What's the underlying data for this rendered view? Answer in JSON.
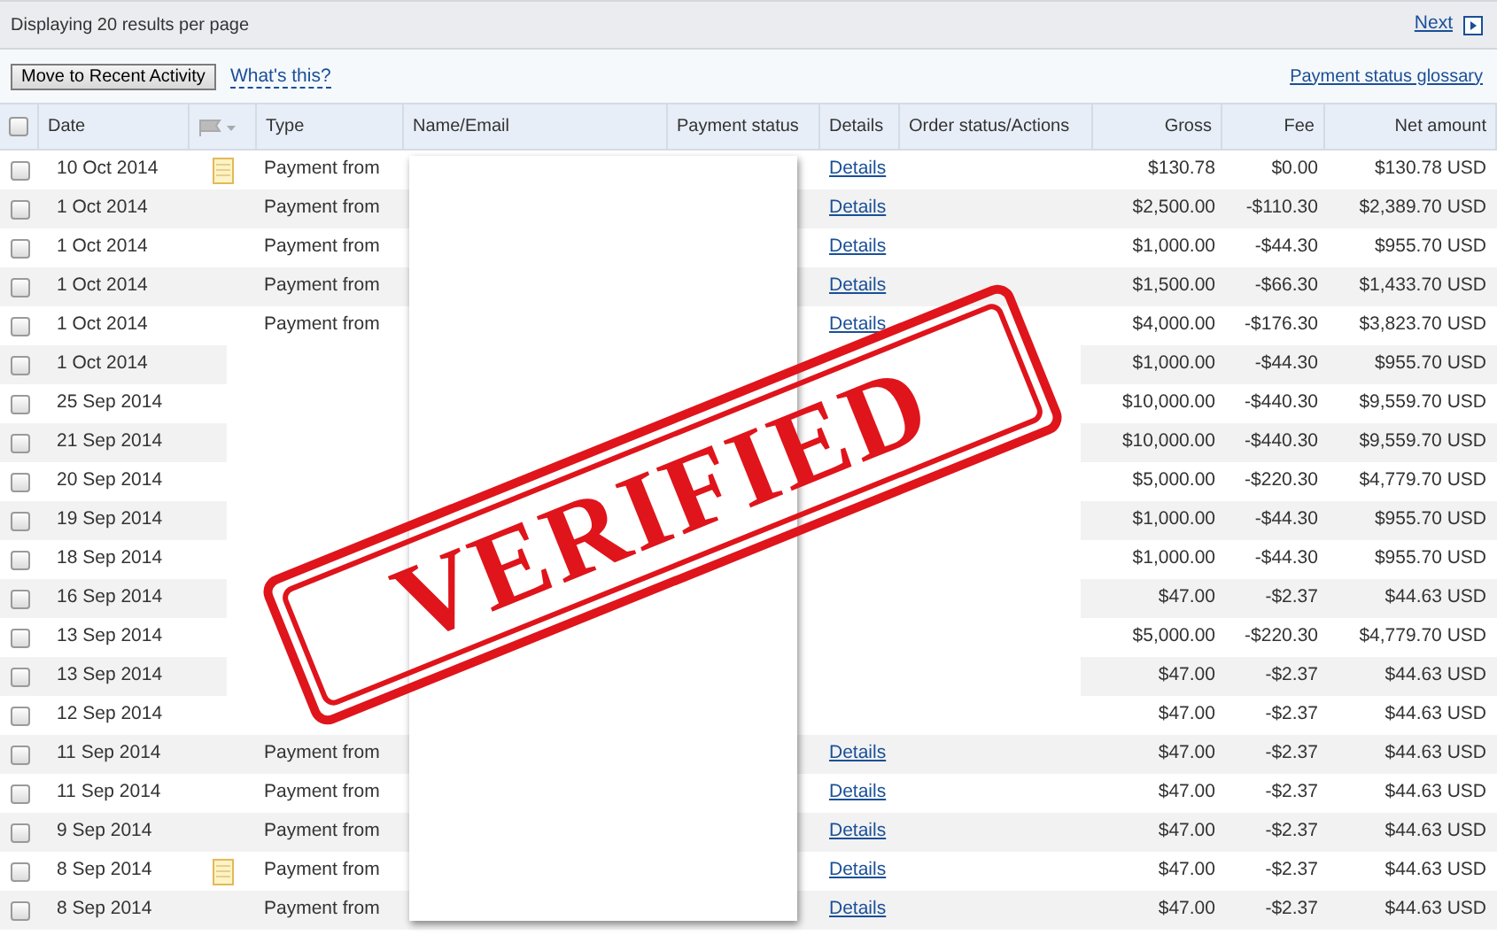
{
  "top_bar": {
    "display_text": "Displaying 20 results per page",
    "next": "Next"
  },
  "toolbar": {
    "button": "Move to Recent Activity",
    "help_link": "What's this?",
    "glossary_link": "Payment status glossary"
  },
  "table": {
    "select_all_checked": false,
    "columns": [
      "Date",
      "Type",
      "Name/Email",
      "Payment status",
      "Details",
      "Order status/Actions",
      "Gross",
      "Fee",
      "Net amount"
    ],
    "rows": [
      {
        "checked": false,
        "date": "10 Oct 2014",
        "note": true,
        "type": "Payment from",
        "details": "Details",
        "gross": "$130.78",
        "fee": "$0.00",
        "net": "$130.78 USD"
      },
      {
        "checked": false,
        "date": "1 Oct 2014",
        "note": false,
        "type": "Payment from",
        "details": "Details",
        "gross": "$2,500.00",
        "fee": "-$110.30",
        "net": "$2,389.70 USD"
      },
      {
        "checked": false,
        "date": "1 Oct 2014",
        "note": false,
        "type": "Payment from",
        "details": "Details",
        "gross": "$1,000.00",
        "fee": "-$44.30",
        "net": "$955.70 USD"
      },
      {
        "checked": false,
        "date": "1 Oct 2014",
        "note": false,
        "type": "Payment from",
        "details": "Details",
        "gross": "$1,500.00",
        "fee": "-$66.30",
        "net": "$1,433.70 USD"
      },
      {
        "checked": false,
        "date": "1 Oct 2014",
        "note": false,
        "type": "Payment from",
        "details": "Details",
        "gross": "$4,000.00",
        "fee": "-$176.30",
        "net": "$3,823.70 USD"
      },
      {
        "checked": false,
        "date": "1 Oct 2014",
        "note": false,
        "gross": "$1,000.00",
        "fee": "-$44.30",
        "net": "$955.70 USD"
      },
      {
        "checked": false,
        "date": "25 Sep 2014",
        "note": false,
        "gross": "$10,000.00",
        "fee": "-$440.30",
        "net": "$9,559.70 USD"
      },
      {
        "checked": false,
        "date": "21 Sep 2014",
        "note": false,
        "gross": "$10,000.00",
        "fee": "-$440.30",
        "net": "$9,559.70 USD"
      },
      {
        "checked": false,
        "date": "20 Sep 2014",
        "note": false,
        "gross": "$5,000.00",
        "fee": "-$220.30",
        "net": "$4,779.70 USD"
      },
      {
        "checked": false,
        "date": "19 Sep 2014",
        "note": false,
        "gross": "$1,000.00",
        "fee": "-$44.30",
        "net": "$955.70 USD"
      },
      {
        "checked": false,
        "date": "18 Sep 2014",
        "note": false,
        "gross": "$1,000.00",
        "fee": "-$44.30",
        "net": "$955.70 USD"
      },
      {
        "checked": false,
        "date": "16 Sep 2014",
        "note": false,
        "gross": "$47.00",
        "fee": "-$2.37",
        "net": "$44.63 USD"
      },
      {
        "checked": false,
        "date": "13 Sep 2014",
        "note": false,
        "gross": "$5,000.00",
        "fee": "-$220.30",
        "net": "$4,779.70 USD"
      },
      {
        "checked": false,
        "date": "13 Sep 2014",
        "note": false,
        "gross": "$47.00",
        "fee": "-$2.37",
        "net": "$44.63 USD"
      },
      {
        "checked": false,
        "date": "12 Sep 2014",
        "note": false,
        "gross": "$47.00",
        "fee": "-$2.37",
        "net": "$44.63 USD"
      },
      {
        "checked": false,
        "date": "11 Sep 2014",
        "note": false,
        "type": "Payment from",
        "details": "Details",
        "gross": "$47.00",
        "fee": "-$2.37",
        "net": "$44.63 USD"
      },
      {
        "checked": false,
        "date": "11 Sep 2014",
        "note": false,
        "type": "Payment from",
        "details": "Details",
        "gross": "$47.00",
        "fee": "-$2.37",
        "net": "$44.63 USD"
      },
      {
        "checked": false,
        "date": "9 Sep 2014",
        "note": false,
        "type": "Payment from",
        "details": "Details",
        "gross": "$47.00",
        "fee": "-$2.37",
        "net": "$44.63 USD"
      },
      {
        "checked": false,
        "date": "8 Sep 2014",
        "note": true,
        "type": "Payment from",
        "details": "Details",
        "gross": "$47.00",
        "fee": "-$2.37",
        "net": "$44.63 USD"
      },
      {
        "checked": false,
        "date": "8 Sep 2014",
        "note": false,
        "type": "Payment from",
        "details": "Details",
        "gross": "$47.00",
        "fee": "-$2.37",
        "net": "$44.63 USD"
      }
    ]
  },
  "stamp": {
    "text": "VERIFIED"
  }
}
